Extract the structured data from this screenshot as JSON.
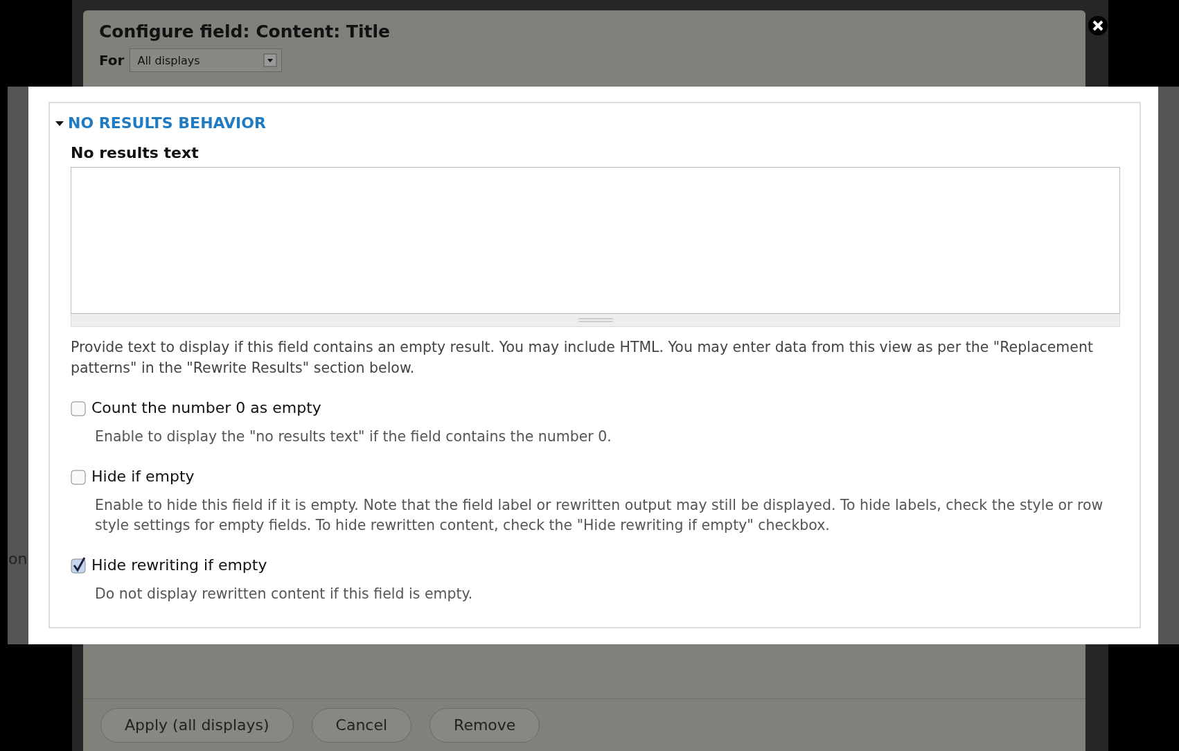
{
  "dialog": {
    "title": "Configure field: Content: Title",
    "for_label": "For",
    "display_select": {
      "value": "All displays"
    },
    "buttons": [
      "Apply (all displays)",
      "Cancel",
      "Remove"
    ]
  },
  "background_fragments": [
    "on"
  ],
  "section": {
    "title": "NO RESULTS BEHAVIOR",
    "expanded": true,
    "textarea_label": "No results text",
    "help": "Provide text to display if this field contains an empty result. You may include HTML. You may enter data from this view as per the \"Replacement patterns\" in the \"Rewrite Results\" section below.",
    "options": [
      {
        "label": "Count the number 0 as empty",
        "checked": false,
        "description": "Enable to display the \"no results text\" if the field contains the number 0."
      },
      {
        "label": "Hide if empty",
        "checked": false,
        "description": "Enable to hide this field if it is empty. Note that the field label or rewritten output may still be displayed. To hide labels, check the style or row style settings for empty fields. To hide rewritten content, check the \"Hide rewriting if empty\" checkbox."
      },
      {
        "label": "Hide rewriting if empty",
        "checked": true,
        "description": "Do not display rewritten content if this field is empty."
      }
    ]
  }
}
